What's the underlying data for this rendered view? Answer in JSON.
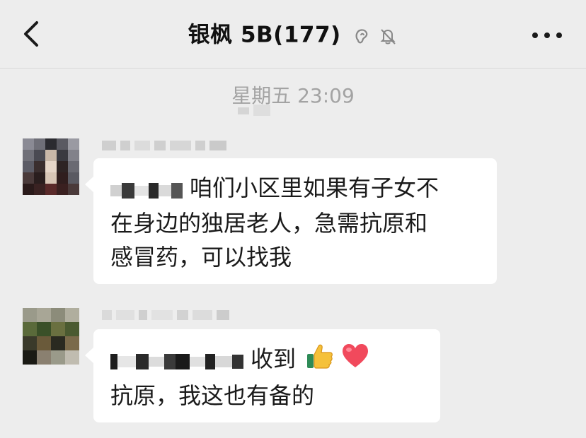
{
  "header": {
    "title": "银枫 5B",
    "member_count": "(177)",
    "icons": [
      "chevron-left-icon",
      "ear-icon",
      "mute-bell-icon",
      "more-dots-icon"
    ]
  },
  "timestamp": "星期五 23:09",
  "messages": [
    {
      "avatar": "blurred-avatar",
      "sender_name": "",
      "text_lines": [
        "咱们小区里如果有子女不",
        "在身边的独居老人，急需抗原和",
        "感冒药，可以找我"
      ]
    },
    {
      "avatar": "blurred-avatar",
      "sender_name": "",
      "text_lines": [
        "收到",
        "抗原，我这也有备的"
      ],
      "emoji": [
        "thumbs-up-icon",
        "red-heart-icon"
      ]
    }
  ],
  "colors": {
    "background": "#ededed",
    "bubble": "#ffffff",
    "time": "#a3a3a3",
    "text": "#1a1a1a"
  }
}
